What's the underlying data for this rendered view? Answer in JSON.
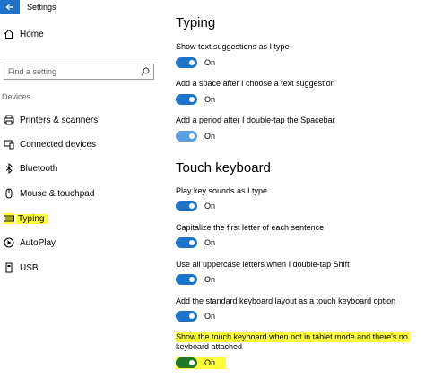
{
  "window": {
    "title": "Settings"
  },
  "sidebar": {
    "home_label": "Home",
    "search_placeholder": "Find a setting",
    "section_label": "Devices",
    "items": [
      {
        "label": "Printers & scanners",
        "icon": "printer-icon"
      },
      {
        "label": "Connected devices",
        "icon": "connected-devices-icon"
      },
      {
        "label": "Bluetooth",
        "icon": "bluetooth-icon"
      },
      {
        "label": "Mouse & touchpad",
        "icon": "mouse-icon"
      },
      {
        "label": "Typing",
        "icon": "keyboard-icon",
        "selected": true
      },
      {
        "label": "AutoPlay",
        "icon": "autoplay-icon"
      },
      {
        "label": "USB",
        "icon": "usb-icon"
      }
    ]
  },
  "typing": {
    "heading": "Typing",
    "options": [
      {
        "label": "Show text suggestions as I type",
        "state": "On",
        "on": true
      },
      {
        "label": "Add a space after I choose a text suggestion",
        "state": "On",
        "on": true
      },
      {
        "label": "Add a period after I double-tap the Spacebar",
        "state": "On",
        "on": true
      }
    ]
  },
  "touch_keyboard": {
    "heading": "Touch keyboard",
    "options": [
      {
        "label": "Play key sounds as I type",
        "state": "On",
        "on": true
      },
      {
        "label": "Capitalize the first letter of each sentence",
        "state": "On",
        "on": true
      },
      {
        "label": "Use all uppercase letters when I double-tap Shift",
        "state": "On",
        "on": true
      },
      {
        "label": "Add the standard keyboard layout as a touch keyboard option",
        "state": "On",
        "on": true
      },
      {
        "label_line1": "Show the touch keyboard when not in tablet mode and there's no",
        "label_line2": "keyboard attached",
        "state": "On",
        "on": true
      }
    ]
  },
  "colors": {
    "accent": "#1e73c8",
    "toggle_light": "#5aa0dc",
    "toggle_green": "#1e7828",
    "highlight": "#ffff3c"
  }
}
